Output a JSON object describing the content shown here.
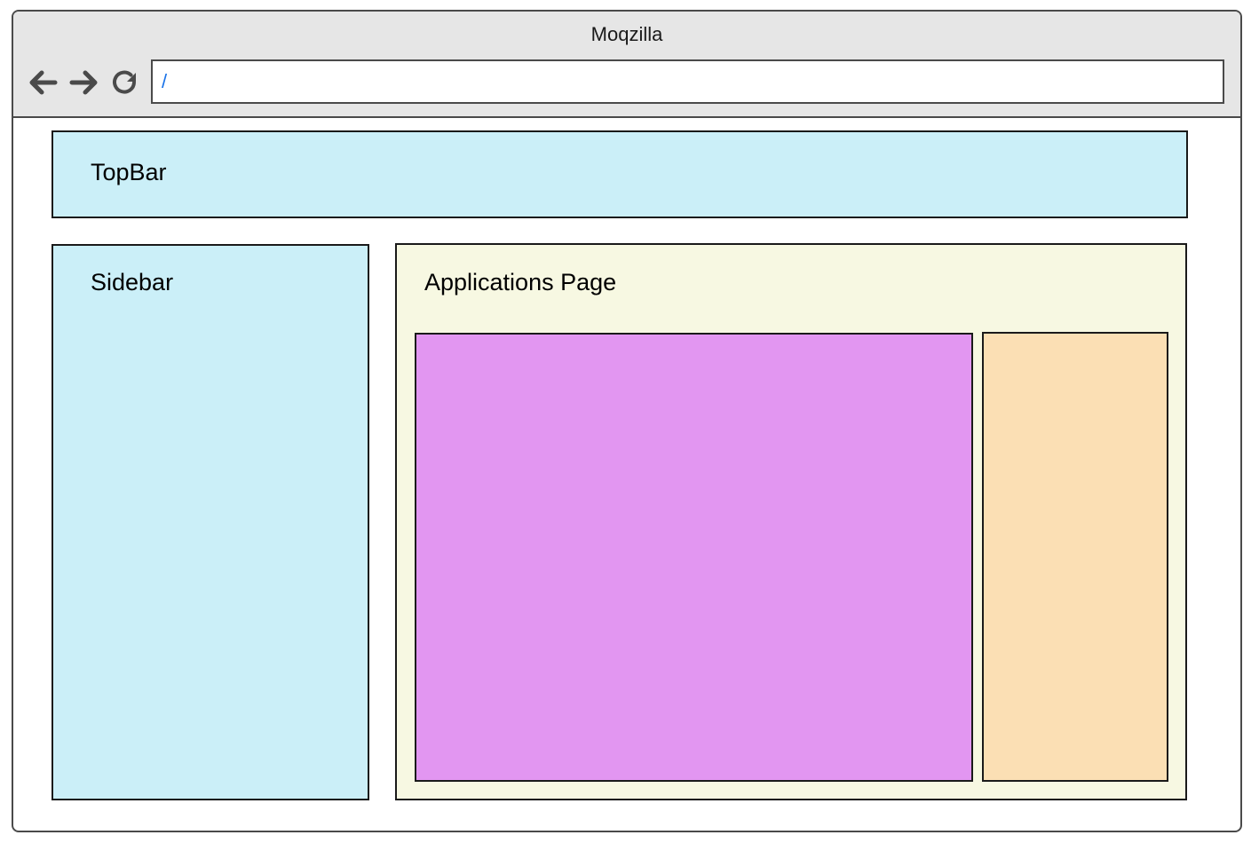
{
  "browser": {
    "title": "Moqzilla",
    "url": "/",
    "icons": {
      "back": "arrow-left-icon",
      "forward": "arrow-right-icon",
      "reload": "reload-icon"
    }
  },
  "regions": {
    "topbar": {
      "label": "TopBar",
      "color": "#cbeff8"
    },
    "sidebar": {
      "label": "Sidebar",
      "color": "#cbeff8"
    },
    "applications_page": {
      "label": "Applications Page",
      "color": "#f7f8e2"
    },
    "main_panel": {
      "color": "#e296f1"
    },
    "side_panel": {
      "color": "#fbdfb4"
    }
  }
}
